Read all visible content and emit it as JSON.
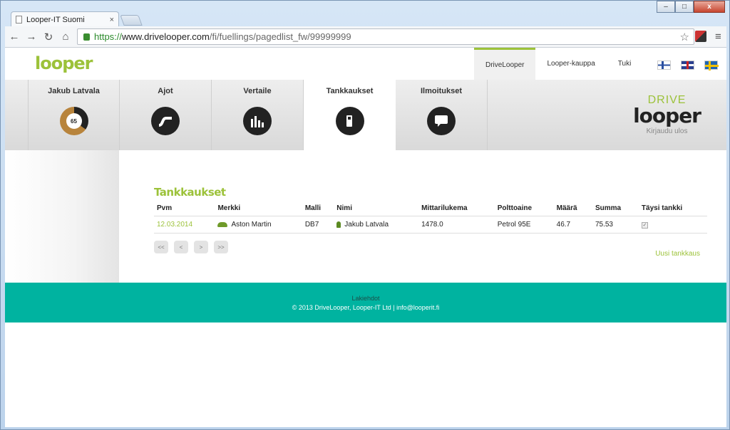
{
  "browser": {
    "tab_title": "Looper-IT Suomi",
    "tab_close": "×",
    "url_scheme": "https://",
    "url_host": "www.drivelooper.com",
    "url_path": "/fi/fuellings/pagedlist_fw/99999999",
    "back": "←",
    "forward": "→",
    "reload": "↻",
    "home": "⌂",
    "star": "☆",
    "menu": "≡",
    "win_min": "–",
    "win_max": "□",
    "win_close": "x"
  },
  "header": {
    "logo": "looper",
    "topnav": [
      "DriveLooper",
      "Looper-kauppa",
      "Tuki"
    ],
    "flags": [
      "fi",
      "gb",
      "se"
    ]
  },
  "menu": {
    "items": [
      {
        "label": "Jakub Latvala",
        "icon": "donut-gauge-icon",
        "value": "65"
      },
      {
        "label": "Ajot",
        "icon": "road-icon"
      },
      {
        "label": "Vertaile",
        "icon": "bar-chart-icon"
      },
      {
        "label": "Tankkaukset",
        "icon": "fuel-pump-icon"
      },
      {
        "label": "Ilmoitukset",
        "icon": "speech-bubble-icon"
      }
    ],
    "brand_drive": "DRIVE",
    "brand_looper": "looper",
    "logout": "Kirjaudu ulos"
  },
  "main": {
    "title": "Tankkaukset",
    "columns": [
      "Pvm",
      "Merkki",
      "Malli",
      "Nimi",
      "Mittarilukema",
      "Polttoaine",
      "Määrä",
      "Summa",
      "Täysi tankki"
    ],
    "rows": [
      {
        "date": "12.03.2014",
        "make": "Aston Martin",
        "model": "DB7",
        "name": "Jakub Latvala",
        "odometer": "1478.0",
        "fuel": "Petrol 95E",
        "amount": "46.7",
        "sum": "75.53",
        "full": true
      }
    ],
    "pager": [
      "<<",
      "<",
      ">",
      ">>"
    ],
    "new_link": "Uusi tankkaus"
  },
  "footer": {
    "terms": "Lakiehdot",
    "copyright": "© 2013 DriveLooper, Looper-IT Ltd | info@looperit.fi"
  },
  "colors": {
    "accent": "#9cc23a",
    "footer": "#00b3a0"
  }
}
